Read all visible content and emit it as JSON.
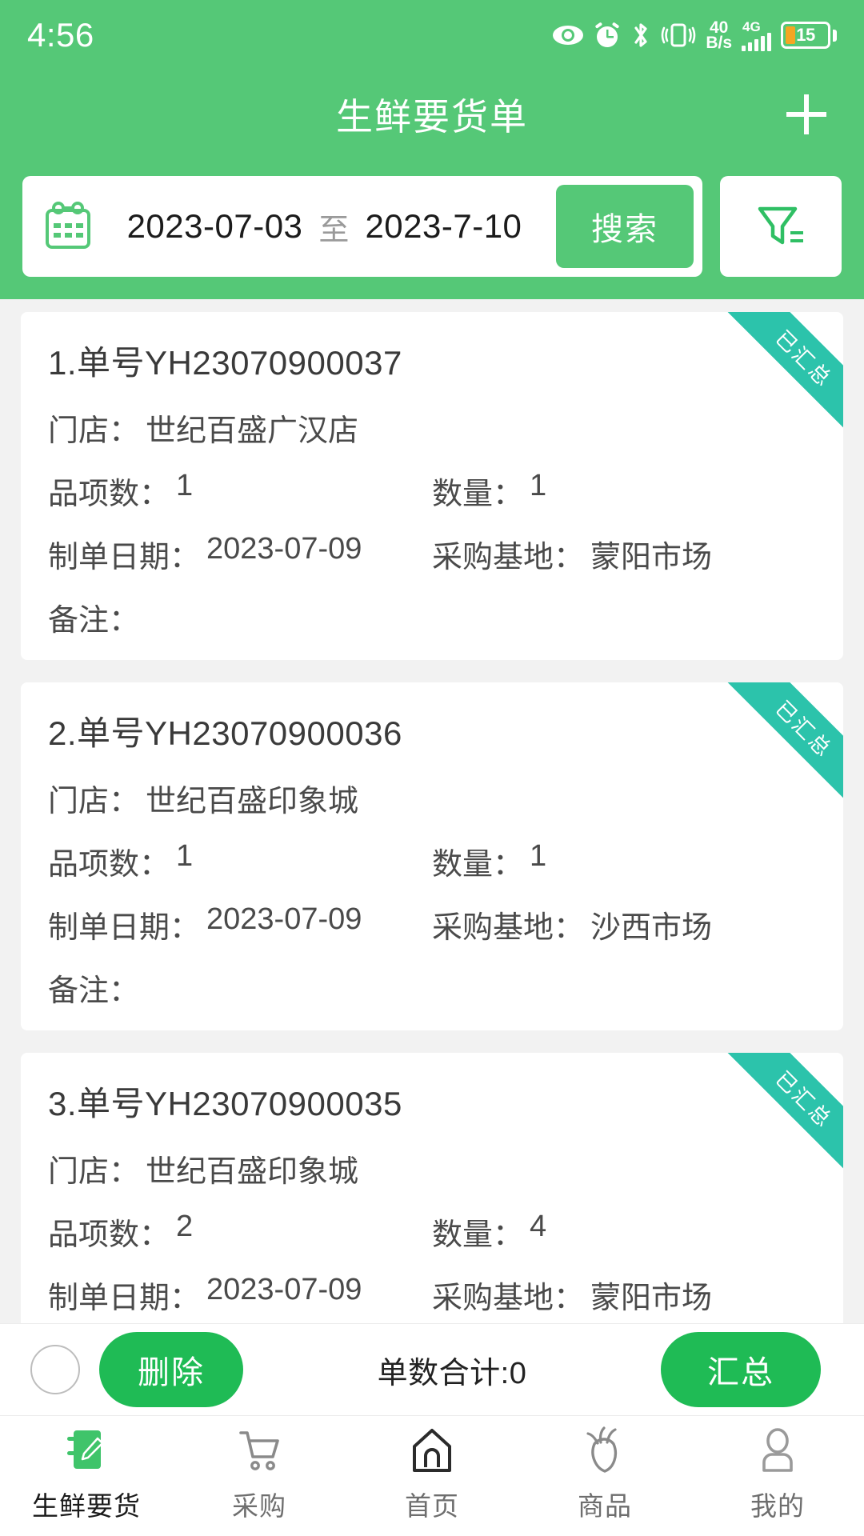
{
  "statusbar": {
    "time": "4:56",
    "net_speed_value": "40",
    "net_speed_unit": "B/s",
    "network_type": "4G",
    "battery_level": "15",
    "icons": [
      "eye-icon",
      "alarm-clock-icon",
      "bluetooth-icon",
      "vibrate-icon",
      "signal-icon",
      "battery-icon"
    ]
  },
  "header": {
    "title": "生鲜要货单",
    "add_label": "+"
  },
  "search": {
    "calendar_icon": "calendar-icon",
    "date_from": "2023-07-03",
    "separator": "至",
    "date_to": "2023-7-10",
    "search_label": "搜索",
    "filter_icon": "filter-icon"
  },
  "labels": {
    "store": "门店：",
    "item_count": "品项数：",
    "quantity": "数量：",
    "order_date": "制单日期：",
    "purchase_base": "采购基地：",
    "remark": "备注："
  },
  "orders": [
    {
      "title": "1.单号YH23070900037",
      "badge": "已汇总",
      "store": "世纪百盛广汉店",
      "item_count": "1",
      "quantity": "1",
      "order_date": "2023-07-09",
      "purchase_base": "蒙阳市场",
      "remark": ""
    },
    {
      "title": "2.单号YH23070900036",
      "badge": "已汇总",
      "store": "世纪百盛印象城",
      "item_count": "1",
      "quantity": "1",
      "order_date": "2023-07-09",
      "purchase_base": "沙西市场",
      "remark": ""
    },
    {
      "title": "3.单号YH23070900035",
      "badge": "已汇总",
      "store": "世纪百盛印象城",
      "item_count": "2",
      "quantity": "4",
      "order_date": "2023-07-09",
      "purchase_base": "蒙阳市场",
      "remark": ""
    }
  ],
  "actionbar": {
    "delete_label": "删除",
    "total_label": "单数合计:0",
    "summary_label": "汇总"
  },
  "tabbar": [
    {
      "label": "生鲜要货",
      "icon": "notepad-pencil-icon",
      "active": true
    },
    {
      "label": "采购",
      "icon": "shopping-cart-icon",
      "active": false
    },
    {
      "label": "首页",
      "icon": "home-icon",
      "active": false
    },
    {
      "label": "商品",
      "icon": "radish-icon",
      "active": false
    },
    {
      "label": "我的",
      "icon": "person-icon",
      "active": false
    }
  ],
  "colors": {
    "header_green": "#55c877",
    "button_green": "#1fbb55",
    "ribbon_teal": "#2cc3ab",
    "battery_orange": "#f5a623"
  }
}
